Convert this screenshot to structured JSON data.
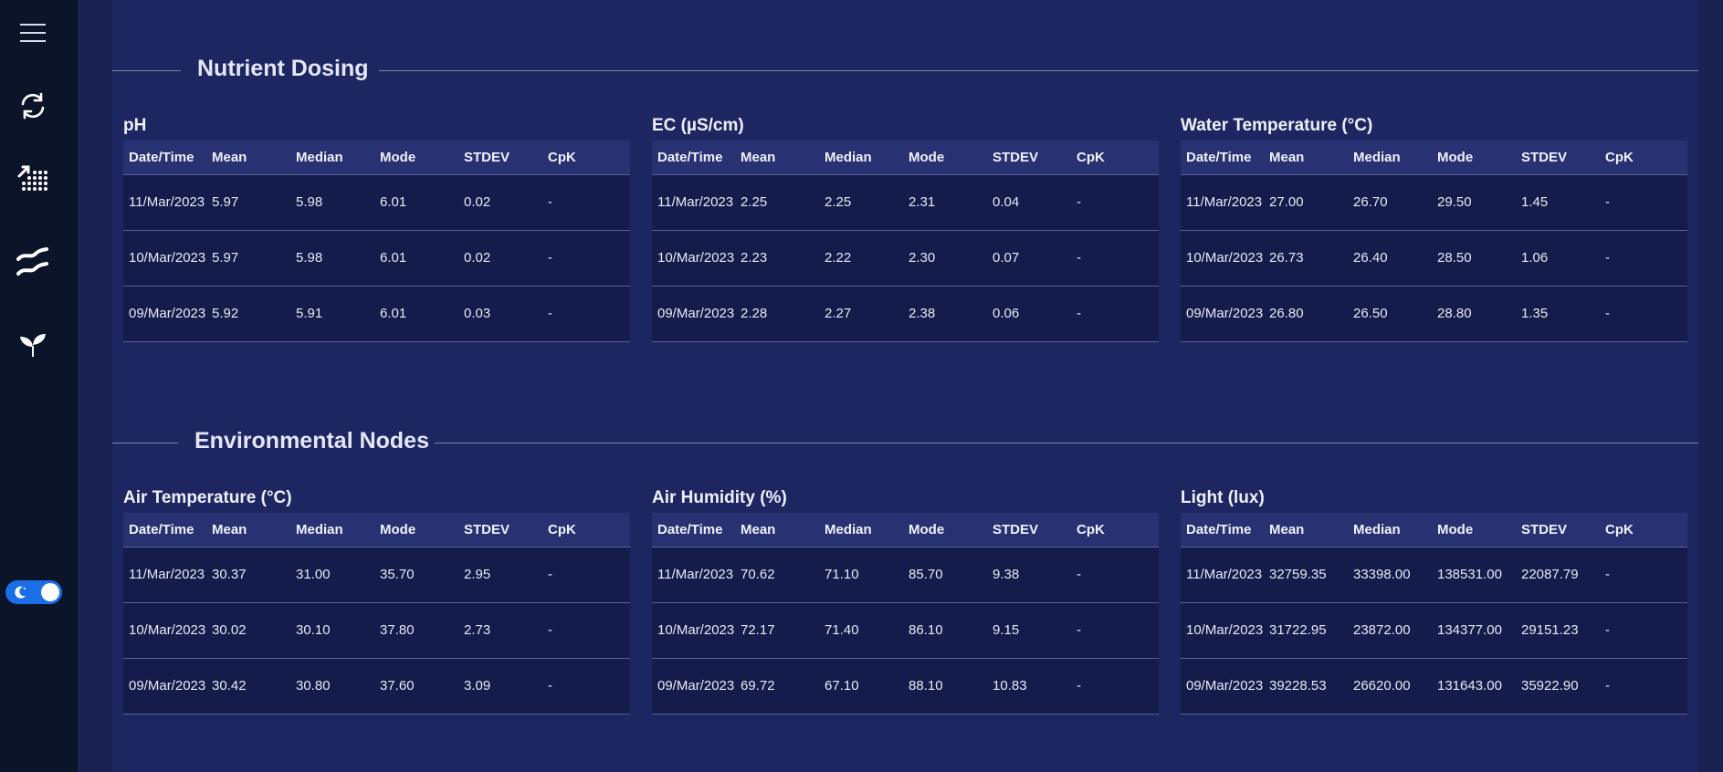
{
  "sidebar": {
    "icons": [
      "menu-icon",
      "refresh-icon",
      "trend-dots-icon",
      "wave-icon",
      "sprout-icon"
    ],
    "theme_toggle": {
      "state": "dark",
      "icon": "moon-icon"
    }
  },
  "columns": [
    "Date/Time",
    "Mean",
    "Median",
    "Mode",
    "STDEV",
    "CpK"
  ],
  "sections": [
    {
      "title": "Nutrient Dosing",
      "panels": [
        {
          "title": "pH",
          "rows": [
            [
              "11/Mar/2023",
              "5.97",
              "5.98",
              "6.01",
              "0.02",
              "-"
            ],
            [
              "10/Mar/2023",
              "5.97",
              "5.98",
              "6.01",
              "0.02",
              "-"
            ],
            [
              "09/Mar/2023",
              "5.92",
              "5.91",
              "6.01",
              "0.03",
              "-"
            ]
          ]
        },
        {
          "title": "EC (µS/cm)",
          "rows": [
            [
              "11/Mar/2023",
              "2.25",
              "2.25",
              "2.31",
              "0.04",
              "-"
            ],
            [
              "10/Mar/2023",
              "2.23",
              "2.22",
              "2.30",
              "0.07",
              "-"
            ],
            [
              "09/Mar/2023",
              "2.28",
              "2.27",
              "2.38",
              "0.06",
              "-"
            ]
          ]
        },
        {
          "title": "Water Temperature (°C)",
          "rows": [
            [
              "11/Mar/2023",
              "27.00",
              "26.70",
              "29.50",
              "1.45",
              "-"
            ],
            [
              "10/Mar/2023",
              "26.73",
              "26.40",
              "28.50",
              "1.06",
              "-"
            ],
            [
              "09/Mar/2023",
              "26.80",
              "26.50",
              "28.80",
              "1.35",
              "-"
            ]
          ]
        }
      ]
    },
    {
      "title": "Environmental Nodes",
      "panels": [
        {
          "title": "Air Temperature (°C)",
          "rows": [
            [
              "11/Mar/2023",
              "30.37",
              "31.00",
              "35.70",
              "2.95",
              "-"
            ],
            [
              "10/Mar/2023",
              "30.02",
              "30.10",
              "37.80",
              "2.73",
              "-"
            ],
            [
              "09/Mar/2023",
              "30.42",
              "30.80",
              "37.60",
              "3.09",
              "-"
            ]
          ]
        },
        {
          "title": "Air Humidity (%)",
          "rows": [
            [
              "11/Mar/2023",
              "70.62",
              "71.10",
              "85.70",
              "9.38",
              "-"
            ],
            [
              "10/Mar/2023",
              "72.17",
              "71.40",
              "86.10",
              "9.15",
              "-"
            ],
            [
              "09/Mar/2023",
              "69.72",
              "67.10",
              "88.10",
              "10.83",
              "-"
            ]
          ]
        },
        {
          "title": "Light (lux)",
          "rows": [
            [
              "11/Mar/2023",
              "32759.35",
              "33398.00",
              "138531.00",
              "22087.79",
              "-"
            ],
            [
              "10/Mar/2023",
              "31722.95",
              "23872.00",
              "134377.00",
              "29151.23",
              "-"
            ],
            [
              "09/Mar/2023",
              "39228.53",
              "26620.00",
              "131643.00",
              "35922.90",
              "-"
            ]
          ]
        }
      ]
    }
  ]
}
